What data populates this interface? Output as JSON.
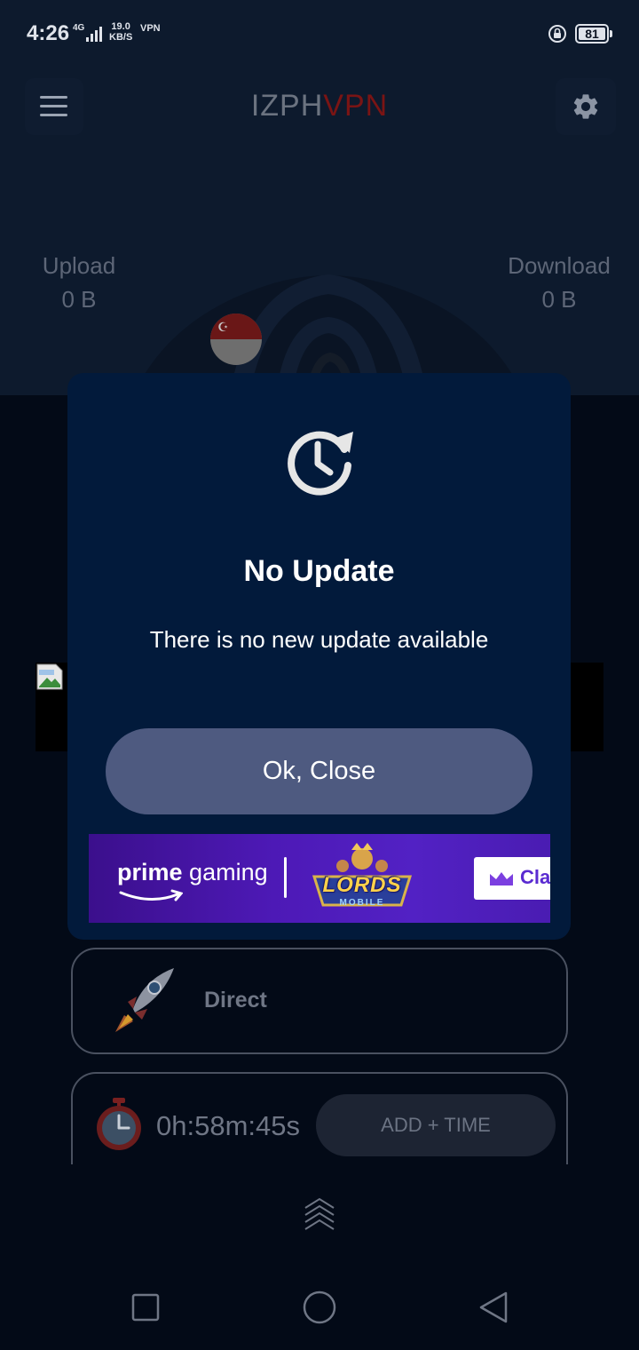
{
  "status_bar": {
    "time": "4:26",
    "network": "4G",
    "speed_value": "19.0",
    "speed_unit": "KB/S",
    "vpn": "VPN",
    "battery": "81"
  },
  "app": {
    "title_part1": "IZPH",
    "title_part2": "VPN",
    "title_colors": {
      "part1": "#6b7380",
      "part2": "#7a1414"
    }
  },
  "stats": {
    "upload_label": "Upload",
    "upload_value": "0 B",
    "download_label": "Download",
    "download_value": "0 B"
  },
  "server": {
    "flag": "singapore-flag"
  },
  "mode": {
    "label": "Direct",
    "icon": "rocket-icon"
  },
  "timer": {
    "remaining": "0h:58m:45s",
    "add_time_label": "ADD + TIME",
    "icon": "stopwatch-icon"
  },
  "dialog": {
    "icon": "update-clock-icon",
    "title": "No Update",
    "message": "There is no new update available",
    "button_label": "Ok, Close",
    "colors": {
      "background": "#021a3b",
      "button": "#4e5a80"
    }
  },
  "ad": {
    "brand_part1": "prime",
    "brand_part2": "gaming",
    "game_title": "LORDS",
    "game_subtitle": "MOBILE",
    "cta_label": "Clai"
  },
  "nav": {
    "recents": "square-icon",
    "home": "circle-icon",
    "back": "triangle-back-icon"
  }
}
